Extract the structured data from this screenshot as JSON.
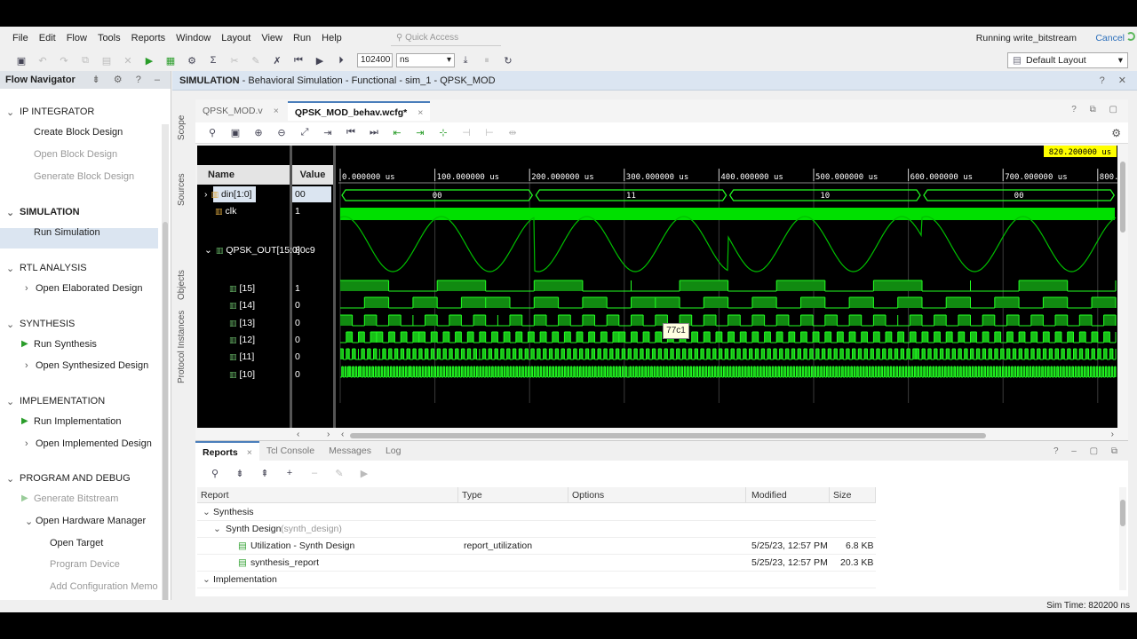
{
  "menu": [
    "File",
    "Edit",
    "Flow",
    "Tools",
    "Reports",
    "Window",
    "Layout",
    "View",
    "Run",
    "Help"
  ],
  "quick_access": "Quick Access",
  "running_text": "Running write_bitstream",
  "cancel_label": "Cancel",
  "toolbar": {
    "time_value": "102400",
    "time_unit": "ns",
    "layout": "Default Layout"
  },
  "flownav": {
    "title": "Flow Navigator",
    "sections": [
      {
        "label": "IP INTEGRATOR",
        "items": [
          "Create Block Design",
          "Open Block Design",
          "Generate Block Design"
        ]
      },
      {
        "label": "SIMULATION",
        "items": [
          "Run Simulation"
        ]
      },
      {
        "label": "RTL ANALYSIS",
        "items": [
          "Open Elaborated Design"
        ]
      },
      {
        "label": "SYNTHESIS",
        "items": [
          "Run Synthesis",
          "Open Synthesized Design"
        ]
      },
      {
        "label": "IMPLEMENTATION",
        "items": [
          "Run Implementation",
          "Open Implemented Design"
        ]
      },
      {
        "label": "PROGRAM AND DEBUG",
        "items": [
          "Generate Bitstream",
          "Open Hardware Manager",
          "Open Target",
          "Program Device",
          "Add Configuration Memory Device"
        ]
      }
    ]
  },
  "sim_header": {
    "bold": "SIMULATION",
    "rest": " - Behavioral Simulation - Functional - sim_1 - QPSK_MOD"
  },
  "side_tabs": [
    "Scope",
    "Sources",
    "Objects",
    "Protocol Instances"
  ],
  "editor_tabs": [
    {
      "label": "QPSK_MOD.v",
      "active": false
    },
    {
      "label": "QPSK_MOD_behav.wcfg*",
      "active": true
    }
  ],
  "wave": {
    "name_header": "Name",
    "value_header": "Value",
    "cursor_time": "820.200000 us",
    "time_ticks": [
      "0.000000 us",
      "100.000000 us",
      "200.000000 us",
      "300.000000 us",
      "400.000000 us",
      "500.000000 us",
      "600.000000 us",
      "700.000000 us",
      "800."
    ],
    "din_segments": [
      "00",
      "11",
      "10",
      "00"
    ],
    "signals": [
      {
        "name": "din[1:0]",
        "value": "00"
      },
      {
        "name": "clk",
        "value": "1"
      },
      {
        "name": "QPSK_OUT[15:0]",
        "value": "80c9"
      },
      {
        "name": "[15]",
        "value": "1"
      },
      {
        "name": "[14]",
        "value": "0"
      },
      {
        "name": "[13]",
        "value": "0"
      },
      {
        "name": "[12]",
        "value": "0"
      },
      {
        "name": "[11]",
        "value": "0"
      },
      {
        "name": "[10]",
        "value": "0"
      }
    ],
    "tooltip": "77c1"
  },
  "reports": {
    "tabs": [
      "Reports",
      "Tcl Console",
      "Messages",
      "Log"
    ],
    "columns": [
      "Report",
      "Type",
      "Options",
      "Modified",
      "Size"
    ],
    "rows": [
      {
        "level": 0,
        "name": "Synthesis",
        "type": "",
        "modified": "",
        "size": ""
      },
      {
        "level": 1,
        "name": "Synth Design",
        "suffix": "(synth_design)",
        "type": "",
        "modified": "",
        "size": ""
      },
      {
        "level": 2,
        "name": "Utilization - Synth Design",
        "type": "report_utilization",
        "modified": "5/25/23, 12:57 PM",
        "size": "6.8 KB"
      },
      {
        "level": 2,
        "name": "synthesis_report",
        "type": "",
        "modified": "5/25/23, 12:57 PM",
        "size": "20.3 KB"
      },
      {
        "level": 0,
        "name": "Implementation",
        "type": "",
        "modified": "",
        "size": ""
      }
    ]
  },
  "status": "Sim Time: 820200 ns",
  "colors": {
    "wave_green": "#00e000",
    "bright_green": "#22ff22",
    "selection": "#dbe5f1"
  }
}
